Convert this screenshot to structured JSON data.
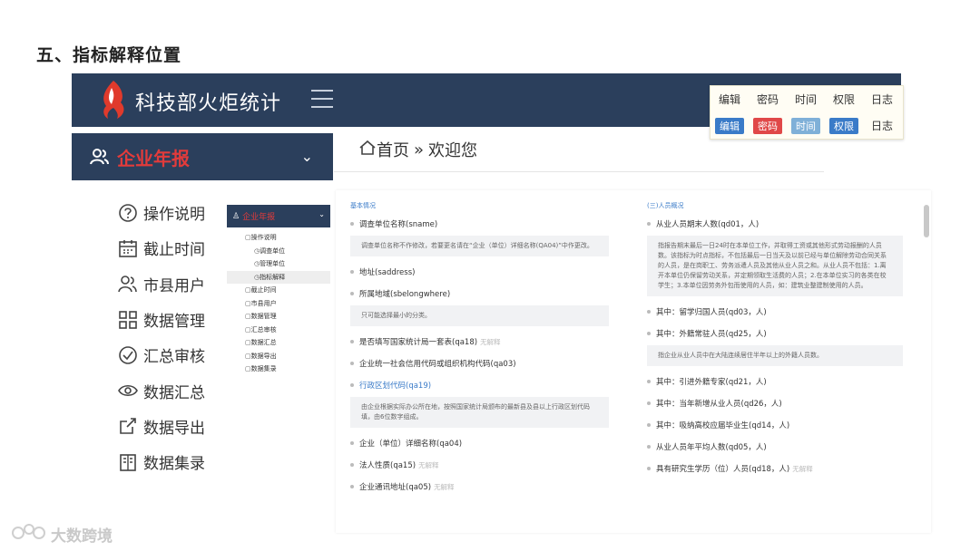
{
  "slide": {
    "title": "五、指标解释位置"
  },
  "app": {
    "title": "科技部火炬统计"
  },
  "legend": {
    "headers": [
      "编辑",
      "密码",
      "时间",
      "权限",
      "日志"
    ],
    "tags": [
      {
        "label": "编辑",
        "color": "#3a7bc8"
      },
      {
        "label": "密码",
        "color": "#e04848"
      },
      {
        "label": "时间",
        "color": "#7fb0d8"
      },
      {
        "label": "权限",
        "color": "#3a7bc8"
      },
      {
        "label": "日志",
        "color": ""
      }
    ]
  },
  "sidebar": {
    "header": "企业年报",
    "items": [
      {
        "label": "操作说明",
        "icon": "question-circle-icon"
      },
      {
        "label": "截止时间",
        "icon": "calendar-icon"
      },
      {
        "label": "市县用户",
        "icon": "users-icon"
      },
      {
        "label": "数据管理",
        "icon": "grid-icon"
      },
      {
        "label": "汇总审核",
        "icon": "check-circle-icon"
      },
      {
        "label": "数据汇总",
        "icon": "eye-icon"
      },
      {
        "label": "数据导出",
        "icon": "export-icon"
      },
      {
        "label": "数据集录",
        "icon": "book-icon"
      }
    ]
  },
  "breadcrumb": {
    "home": "首页",
    "sep": "»",
    "current": "欢迎您"
  },
  "mini_sidebar": {
    "header": "企业年报",
    "items": [
      {
        "label": "操作说明",
        "sub": false,
        "active": false
      },
      {
        "label": "调查单位",
        "sub": true,
        "active": false
      },
      {
        "label": "管理单位",
        "sub": true,
        "active": false
      },
      {
        "label": "指标解释",
        "sub": true,
        "active": true
      },
      {
        "label": "截止时间",
        "sub": false,
        "active": false
      },
      {
        "label": "市县用户",
        "sub": false,
        "active": false
      },
      {
        "label": "数据管理",
        "sub": false,
        "active": false
      },
      {
        "label": "汇总审核",
        "sub": false,
        "active": false
      },
      {
        "label": "数据汇总",
        "sub": false,
        "active": false
      },
      {
        "label": "数据导出",
        "sub": false,
        "active": false
      },
      {
        "label": "数据集录",
        "sub": false,
        "active": false
      }
    ]
  },
  "left_col": {
    "section": "基本情况",
    "fields": [
      {
        "label": "调查单位名称(sname)",
        "note": "调查单位名称不作修改，若要更名请在“企业（单位）详细名称(QA04)”中作更改。"
      },
      {
        "label": "地址(saddress)"
      },
      {
        "label": "所属地域(sbelongwhere)",
        "note": "只可能选择最小的分类。"
      },
      {
        "label": "是否填写国家统计局一套表(qa18)",
        "hint": "无解释"
      },
      {
        "label": "企业统一社会信用代码或组织机构代码(qa03)"
      },
      {
        "label": "行政区划代码(qa19)",
        "blue": true,
        "note": "由企业根据实际办公所在地，按照国家统计局颁布的最新县及县以上行政区划代码填，由6位数字组成。"
      },
      {
        "label": "企业（单位）详细名称(qa04)"
      },
      {
        "label": "法人性质(qa15)",
        "hint": "无解释"
      },
      {
        "label": "企业通讯地址(qa05)",
        "hint": "无解释"
      }
    ]
  },
  "right_col": {
    "section": "(三)人员概况",
    "fields": [
      {
        "label": "从业人员期末人数(qd01，人)",
        "note": "指报告期末最后一日24时在本单位工作，并取得工资或其他形式劳动报酬的人员数。该指标为时点指标，不包括最后一日当天及以前已经与单位解除劳动合同关系的人员，是在岗职工、劳务派遣人员及其他从业人员之和。从业人员不包括：1.离开本单位仍保留劳动关系，并定期领取生活费的人员；2.在本单位实习的各类在校学生；3.本单位因劳务外包而使用的人员，如：建筑业整建制使用的人员。"
      },
      {
        "label": "其中：留学归国人员(qd03，人)"
      },
      {
        "label": "其中：外籍常驻人员(qd25，人)",
        "note": "指企业从业人员中在大陆连续居住半年以上的外籍人员数。"
      },
      {
        "label": "其中：引进外籍专家(qd21，人)"
      },
      {
        "label": "其中：当年新增从业人员(qd26，人)"
      },
      {
        "label": "其中：吸纳高校应届毕业生(qd14，人)"
      },
      {
        "label": "从业人员年平均人数(qd05，人)"
      },
      {
        "label": "具有研究生学历（位）人员(qd18，人)",
        "hint": "无解释"
      }
    ]
  },
  "watermark": "大数跨境"
}
